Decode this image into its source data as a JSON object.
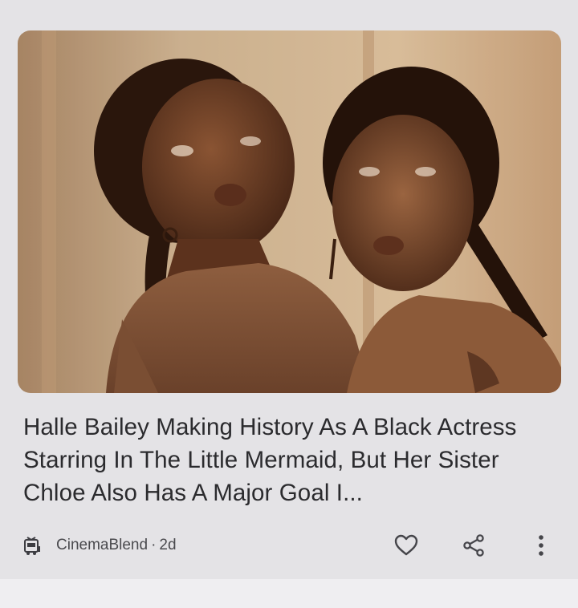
{
  "article": {
    "image_alt": "Two women posing close together in warm sepia-toned light",
    "headline": "Halle Bailey Making History As A Black Actress Starring In The Little Mermaid, But Her Sister Chloe Also Has A Major Goal I...",
    "source": "CinemaBlend",
    "separator": "·",
    "age": "2d"
  },
  "actions": {
    "like_icon": "heart-outline-icon",
    "share_icon": "share-icon",
    "more_icon": "more-vert-icon"
  },
  "colors": {
    "background": "#e4e3e6",
    "headline_text": "#2b2b2e",
    "meta_text": "#4a4a4e",
    "icon": "#45454a"
  }
}
